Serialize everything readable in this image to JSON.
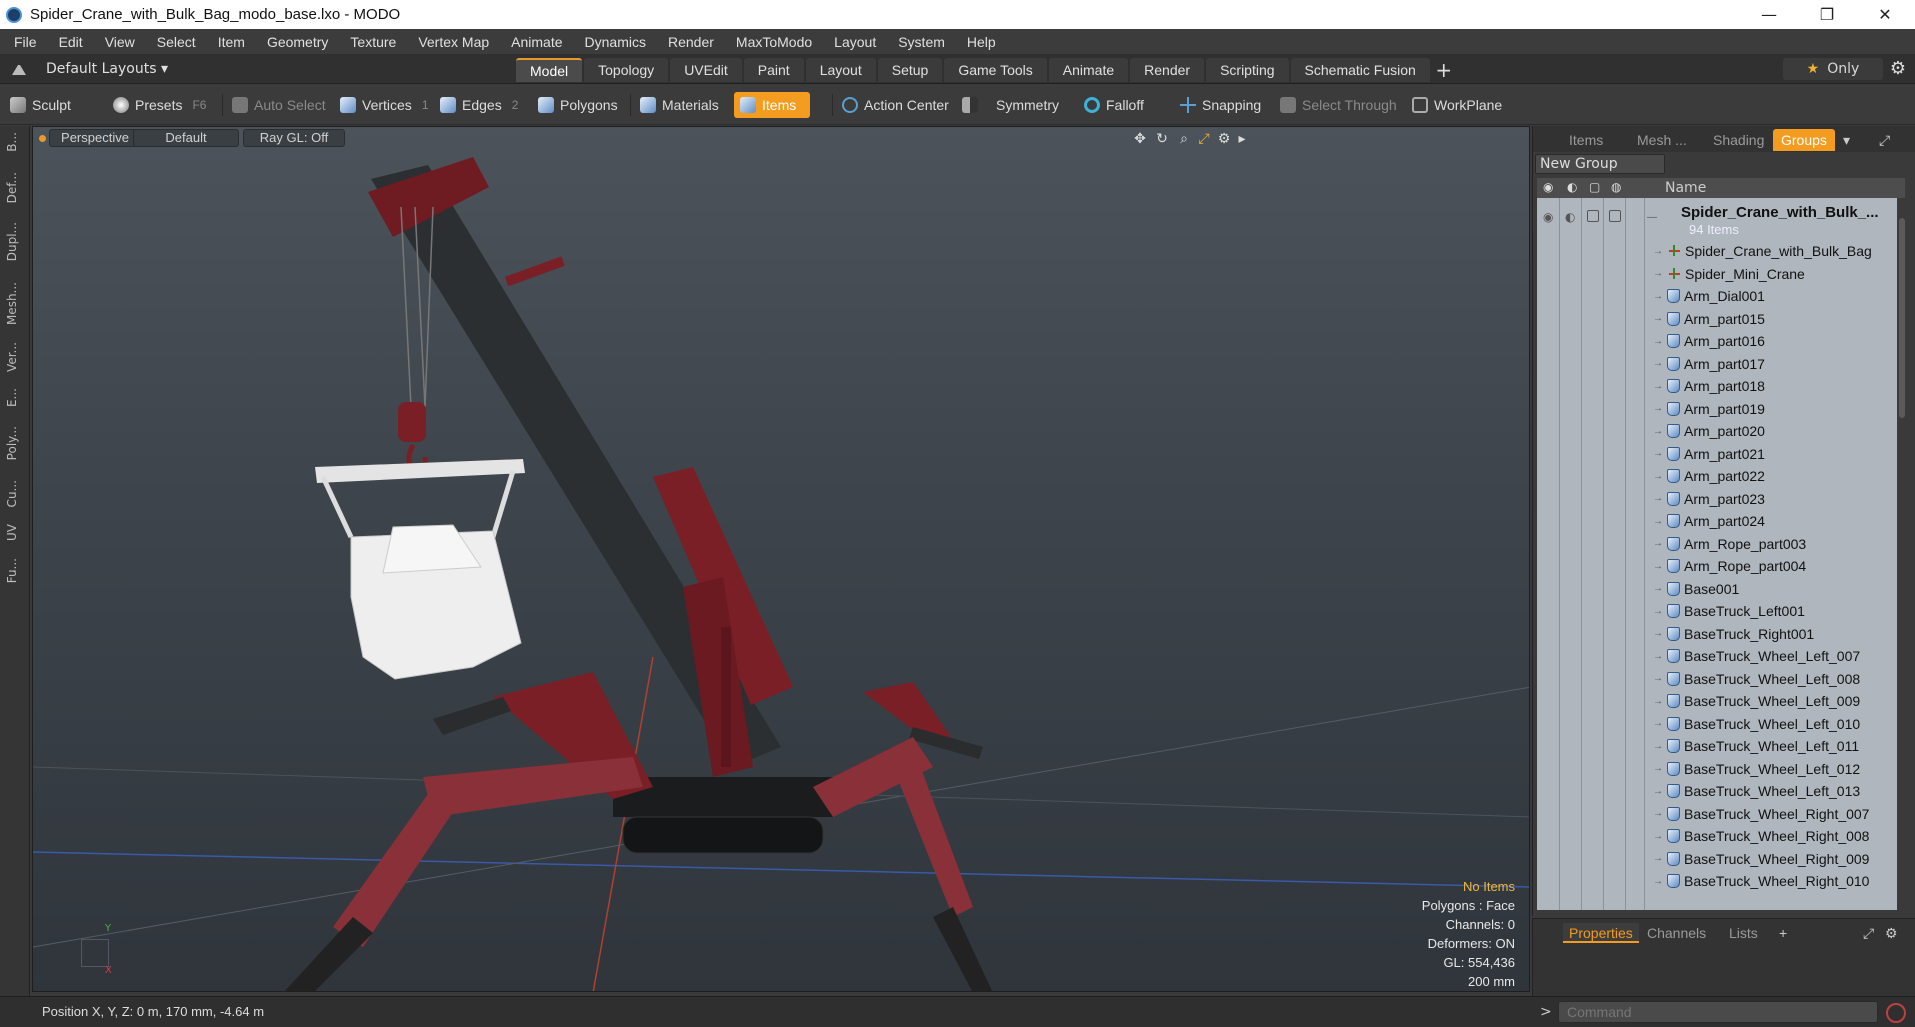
{
  "window": {
    "title": "Spider_Crane_with_Bulk_Bag_modo_base.lxo - MODO",
    "controls": {
      "minimize": "—",
      "maximize": "❐",
      "close": "✕"
    }
  },
  "menu": [
    "File",
    "Edit",
    "View",
    "Select",
    "Item",
    "Geometry",
    "Texture",
    "Vertex Map",
    "Animate",
    "Dynamics",
    "Render",
    "MaxToModo",
    "Layout",
    "System",
    "Help"
  ],
  "layouts": {
    "label": "Default Layouts ▾"
  },
  "tabs": [
    "Model",
    "Topology",
    "UVEdit",
    "Paint",
    "Layout",
    "Setup",
    "Game Tools",
    "Animate",
    "Render",
    "Scripting",
    "Schematic Fusion"
  ],
  "tab_add": "+",
  "only_label": "Only",
  "toolbar": {
    "sculpt": "Sculpt",
    "presets": "Presets",
    "presets_key": "F6",
    "auto_select": "Auto Select",
    "vertices": "Vertices",
    "vertices_count": "1",
    "edges": "Edges",
    "edges_count": "2",
    "polygons": "Polygons",
    "materials": "Materials",
    "items": "Items",
    "action_center": "Action Center",
    "symmetry": "Symmetry",
    "falloff": "Falloff",
    "snapping": "Snapping",
    "select_through": "Select Through",
    "workplane": "WorkPlane"
  },
  "left_tabs": [
    "B...",
    "Def...",
    "Dupl...",
    "Mesh...",
    "Ver...",
    "E...",
    "Poly...",
    "Cu...",
    "UV",
    "Fu..."
  ],
  "viewport": {
    "view": "Perspective",
    "shading": "Default",
    "raygl": "Ray GL: Off",
    "info": {
      "selection": "No Items",
      "polygons": "Polygons : Face",
      "channels": "Channels: 0",
      "deformers": "Deformers: ON",
      "gl": "GL: 554,436",
      "scale": "200 mm"
    },
    "axis_y": "Y",
    "axis_x": "X"
  },
  "panel": {
    "tabs": [
      "Items",
      "Mesh ...",
      "Shading",
      "Groups"
    ],
    "active_tab": "Groups",
    "new_group": "New Group",
    "col_name": "Name",
    "root": {
      "name": "Spider_Crane_with_Bulk_...",
      "count": "94 Items"
    },
    "items": [
      {
        "name": "Spider_Crane_with_Bulk_Bag",
        "type": "locator"
      },
      {
        "name": "Spider_Mini_Crane",
        "type": "locator"
      },
      {
        "name": "Arm_Dial001",
        "type": "mesh"
      },
      {
        "name": "Arm_part015",
        "type": "mesh"
      },
      {
        "name": "Arm_part016",
        "type": "mesh"
      },
      {
        "name": "Arm_part017",
        "type": "mesh"
      },
      {
        "name": "Arm_part018",
        "type": "mesh"
      },
      {
        "name": "Arm_part019",
        "type": "mesh"
      },
      {
        "name": "Arm_part020",
        "type": "mesh"
      },
      {
        "name": "Arm_part021",
        "type": "mesh"
      },
      {
        "name": "Arm_part022",
        "type": "mesh"
      },
      {
        "name": "Arm_part023",
        "type": "mesh"
      },
      {
        "name": "Arm_part024",
        "type": "mesh"
      },
      {
        "name": "Arm_Rope_part003",
        "type": "mesh"
      },
      {
        "name": "Arm_Rope_part004",
        "type": "mesh"
      },
      {
        "name": "Base001",
        "type": "mesh"
      },
      {
        "name": "BaseTruck_Left001",
        "type": "mesh"
      },
      {
        "name": "BaseTruck_Right001",
        "type": "mesh"
      },
      {
        "name": "BaseTruck_Wheel_Left_007",
        "type": "mesh"
      },
      {
        "name": "BaseTruck_Wheel_Left_008",
        "type": "mesh"
      },
      {
        "name": "BaseTruck_Wheel_Left_009",
        "type": "mesh"
      },
      {
        "name": "BaseTruck_Wheel_Left_010",
        "type": "mesh"
      },
      {
        "name": "BaseTruck_Wheel_Left_011",
        "type": "mesh"
      },
      {
        "name": "BaseTruck_Wheel_Left_012",
        "type": "mesh"
      },
      {
        "name": "BaseTruck_Wheel_Left_013",
        "type": "mesh"
      },
      {
        "name": "BaseTruck_Wheel_Right_007",
        "type": "mesh"
      },
      {
        "name": "BaseTruck_Wheel_Right_008",
        "type": "mesh"
      },
      {
        "name": "BaseTruck_Wheel_Right_009",
        "type": "mesh"
      },
      {
        "name": "BaseTruck_Wheel_Right_010",
        "type": "mesh"
      }
    ]
  },
  "properties": {
    "tabs": [
      "Properties",
      "Channels",
      "Lists"
    ],
    "add": "+"
  },
  "status": {
    "position": "Position X, Y, Z:   0 m, 170 mm, -4.64 m",
    "command_prompt": ">",
    "command_placeholder": "Command"
  },
  "colors": {
    "accent": "#f39c1f",
    "crane_red": "#7a1f26"
  }
}
